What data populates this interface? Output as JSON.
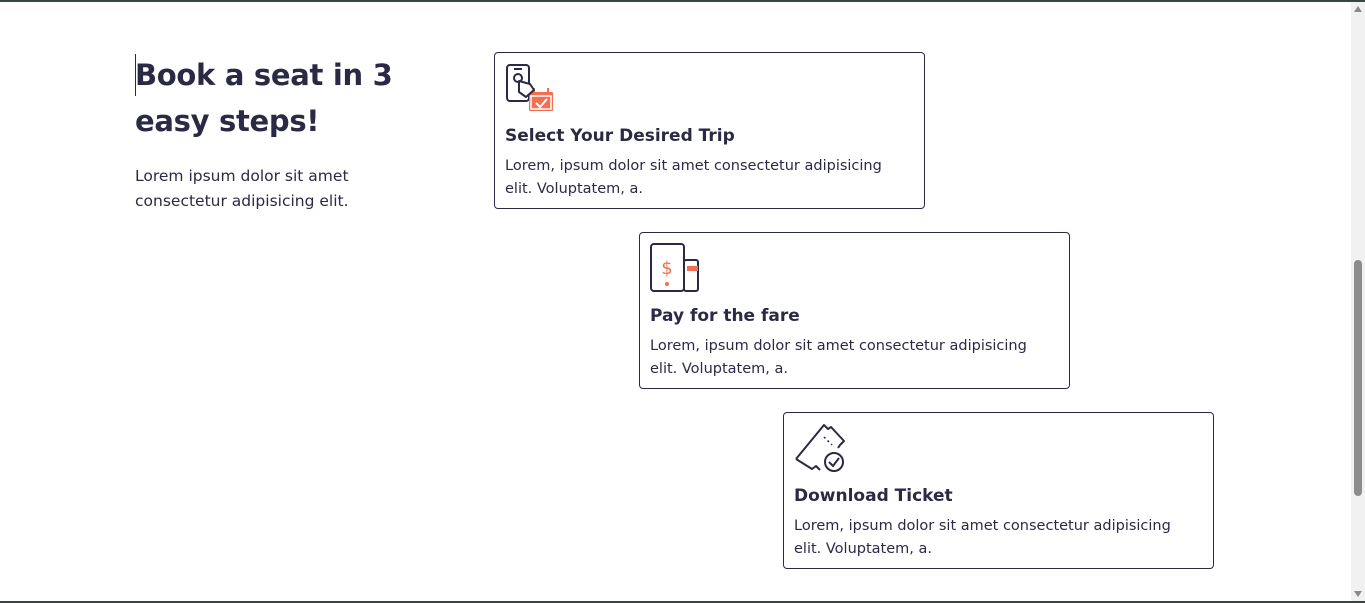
{
  "intro": {
    "heading": "Book a seat in 3 easy steps!",
    "text": "Lorem ipsum dolor sit amet consectetur adipisicing elit."
  },
  "steps": [
    {
      "icon": "touch-phone-calendar-icon",
      "title": "Select Your Desired Trip",
      "description": "Lorem, ipsum dolor sit amet consectetur adipisicing elit. Voluptatem, a."
    },
    {
      "icon": "phone-payment-card-icon",
      "title": "Pay for the fare",
      "description": "Lorem, ipsum dolor sit amet consectetur adipisicing elit. Voluptatem, a."
    },
    {
      "icon": "ticket-check-icon",
      "title": "Download Ticket",
      "description": "Lorem, ipsum dolor sit amet consectetur adipisicing elit. Voluptatem, a."
    }
  ],
  "colors": {
    "text": "#2b2a45",
    "accent": "#f2704f",
    "border": "#2b2a45"
  }
}
